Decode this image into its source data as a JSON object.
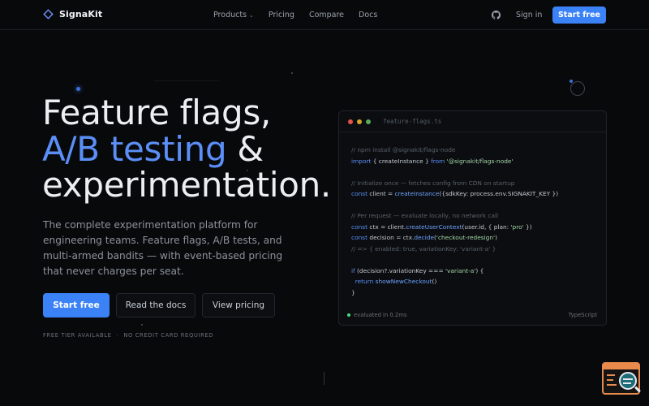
{
  "nav": {
    "brand": "SignaKit",
    "links": [
      {
        "label": "Products",
        "has_dropdown": true
      },
      {
        "label": "Pricing"
      },
      {
        "label": "Compare"
      },
      {
        "label": "Docs"
      }
    ],
    "signin_label": "Sign in",
    "cta_label": "Start free"
  },
  "hero": {
    "title_line1": "Feature flags,",
    "title_line2_accent": "A/B testing",
    "title_line2_rest": " &",
    "title_line3": "experimentation.",
    "subtitle": "The complete experimentation platform for engineering teams. Feature flags, A/B tests, and multi-armed bandits — with event-based pricing that never charges per seat.",
    "primary_cta": "Start free",
    "docs_cta": "Read the docs",
    "pricing_cta": "View pricing",
    "trust_items": [
      "FREE TIER AVAILABLE",
      "NO CREDIT CARD REQUIRED"
    ],
    "trust_separator": "·"
  },
  "code_card": {
    "filename": "feature-flags.ts",
    "lines": {
      "l1": "// npm install @signakit/flags-node",
      "l2_kw": "import",
      "l2_mid": " { createInstance } ",
      "l2_kw2": "from",
      "l2_str": " '@signakit/flags-node'",
      "l4": "// Initialize once — fetches config from CDN on startup",
      "l5_kw": "const",
      "l5_mid": " client = ",
      "l5_fn": "createInstance",
      "l5_rest": "({sdkKey: process.env.SIGNAKIT_KEY })",
      "l7": "// Per request — evaluate locally, no network call",
      "l8_kw": "const",
      "l8_mid": " ctx = client.",
      "l8_fn": "createUserContext",
      "l8_rest": "(user.id, { plan: ",
      "l8_str": "'pro'",
      "l8_end": " })",
      "l9_kw": "const",
      "l9_mid": " decision = ctx.",
      "l9_fn": "decide",
      "l9_open": "(",
      "l9_str": "'checkout-redesign'",
      "l9_end": ")",
      "l10": "// => { enabled: true, variationKey: 'variant-a' }",
      "l12_kw": "if",
      "l12_mid": " (decision?.variationKey === ",
      "l12_str": "'variant-a'",
      "l12_end": ") {",
      "l13_kw": "  return",
      "l13_fn": " showNewCheckout",
      "l13_end": "()",
      "l14": "}"
    },
    "status_text": "evaluated in 0.2ms",
    "language": "TypeScript"
  },
  "colors": {
    "accent": "#3b82f6",
    "accent_text": "#5b8ff7",
    "status_green": "#4ade80"
  }
}
